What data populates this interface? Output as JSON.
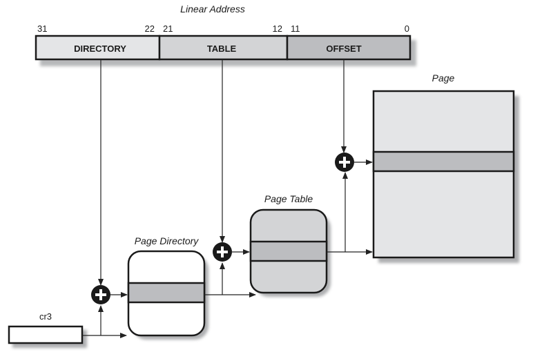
{
  "title": "Linear Address",
  "address_fields": [
    {
      "label": "DIRECTORY",
      "bit_high": "31",
      "bit_low": "22",
      "fill": "#e4e5e7"
    },
    {
      "label": "TABLE",
      "bit_high": "21",
      "bit_low": "12",
      "fill": "#d3d4d6"
    },
    {
      "label": "OFFSET",
      "bit_high": "11",
      "bit_low": "0",
      "fill": "#bcbdc0"
    }
  ],
  "structures": {
    "cr3": {
      "label": "cr3",
      "fill": "#ffffff"
    },
    "page_directory": {
      "label": "Page Directory",
      "fill": "#ffffff"
    },
    "page_table": {
      "label": "Page Table",
      "fill": "#d3d4d6"
    },
    "page": {
      "label": "Page",
      "fill": "#e4e5e7"
    }
  },
  "colors": {
    "entry_highlight": "#bcbdc0",
    "shadow": "#9a9b9e",
    "adder": "#1a1a1a",
    "line": "#222222"
  },
  "icons": {
    "adder": "plus-circle-icon",
    "arrow": "arrowhead-icon"
  }
}
